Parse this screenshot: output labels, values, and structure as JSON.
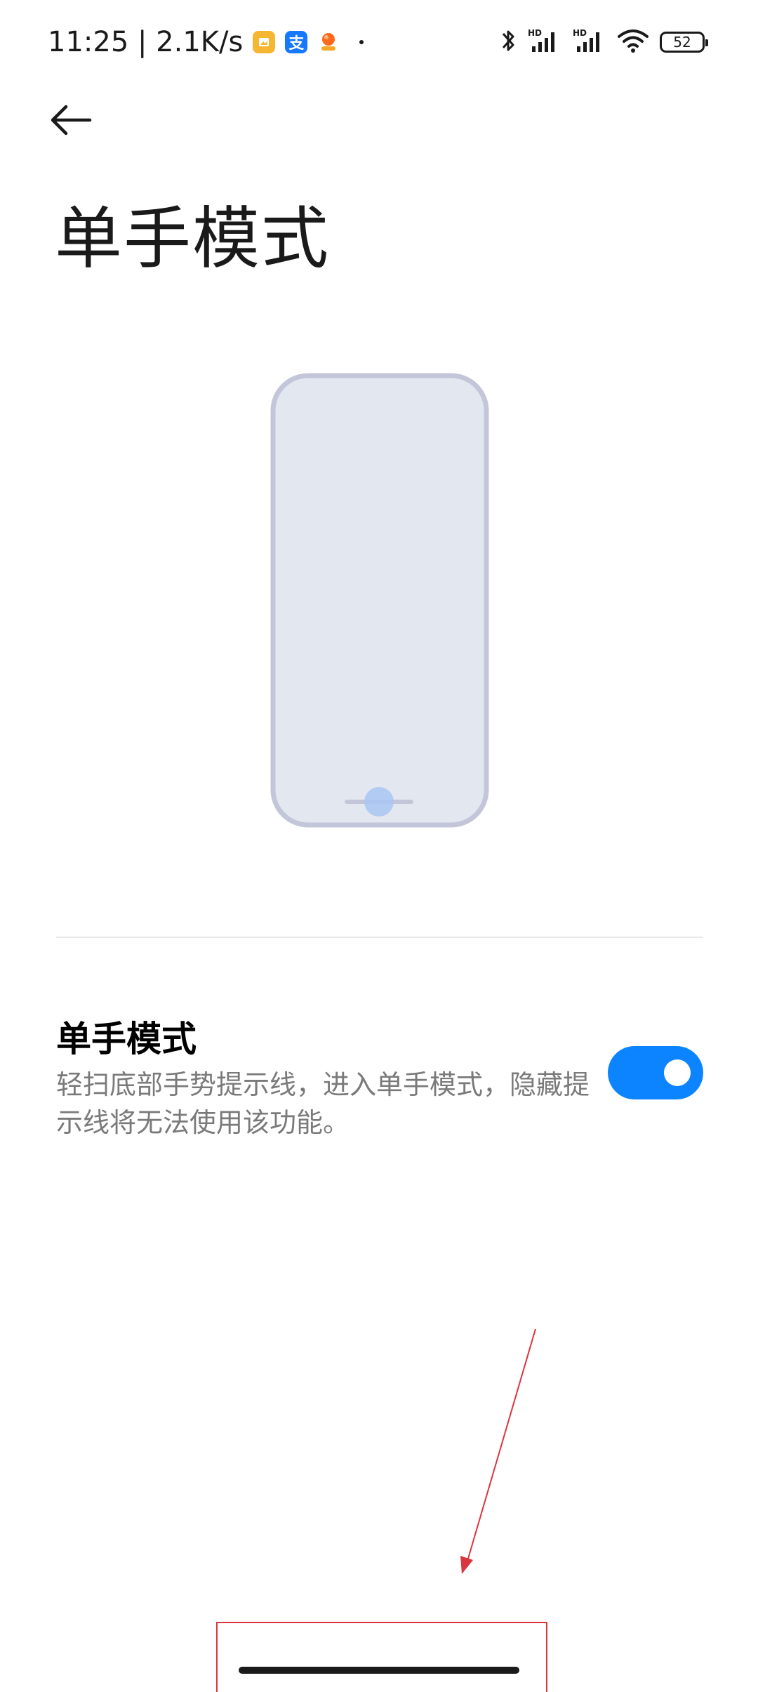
{
  "status_bar": {
    "time": "11:25 | 2.1K/s",
    "battery_level": "52",
    "app_icons": [
      {
        "name": "gallery-icon",
        "glyph": "",
        "color": "#f5b731"
      },
      {
        "name": "alipay-icon",
        "glyph": "支",
        "color": "#1677ff"
      },
      {
        "name": "taobao-icon",
        "glyph": "",
        "color": "#ff6a1a"
      }
    ],
    "indicators": [
      "bluetooth-icon",
      "signal-hd-icon",
      "signal-hd-icon",
      "wifi-icon"
    ]
  },
  "header": {
    "title": "单手模式"
  },
  "setting": {
    "title": "单手模式",
    "description": "轻扫底部手势提示线，进入单手模式，隐藏提示线将无法使用该功能。",
    "enabled": true
  },
  "colors": {
    "accent": "#0d84ff",
    "annotation": "#d9363e",
    "phone_fill": "#e3e7ef",
    "phone_border": "#c3c6d9",
    "touch_dot": "#a9c6f2"
  }
}
